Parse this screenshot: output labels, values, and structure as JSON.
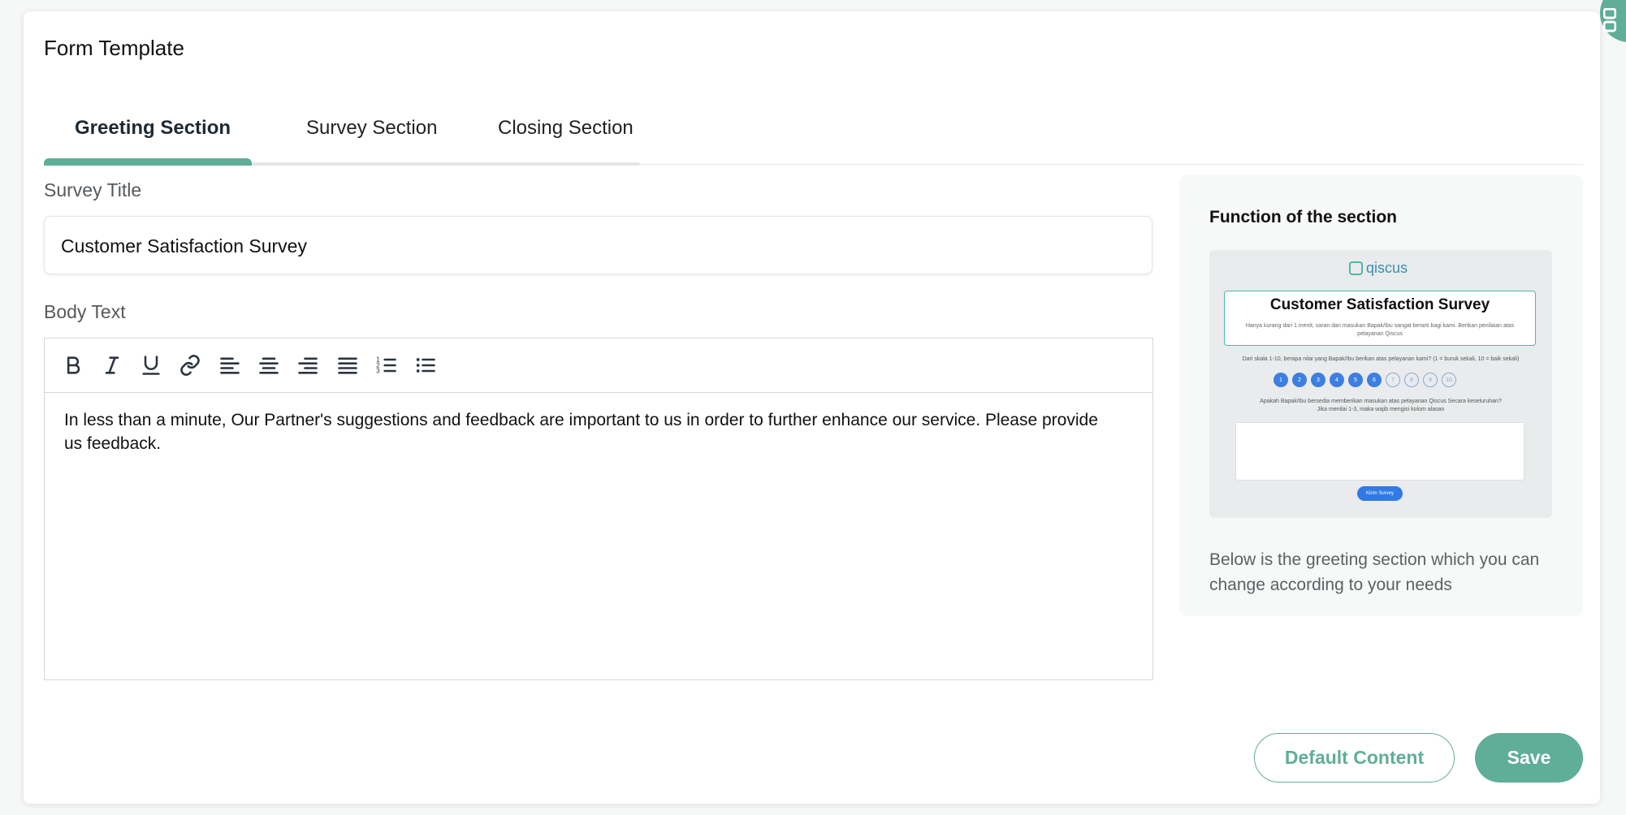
{
  "page": {
    "title": "Form Template"
  },
  "tabs": [
    {
      "label": "Greeting Section",
      "active": true
    },
    {
      "label": "Survey Section",
      "active": false
    },
    {
      "label": "Closing Section",
      "active": false
    }
  ],
  "survey_title": {
    "label": "Survey Title",
    "value": "Customer Satisfaction Survey"
  },
  "body_text": {
    "label": "Body Text",
    "content": "In less than a minute, Our Partner's suggestions and feedback are important to us in order to further enhance our service. Please provide us feedback.",
    "toolbar": [
      "bold-icon",
      "italic-icon",
      "underline-icon",
      "link-icon",
      "align-left-icon",
      "align-center-icon",
      "align-right-icon",
      "align-justify-icon",
      "ordered-list-icon",
      "bullet-list-icon"
    ]
  },
  "info_panel": {
    "title": "Function of the section",
    "description": "Below is the greeting section which you can change according to your needs",
    "preview": {
      "logo_text": "qiscus",
      "heading": "Customer Satisfaction Survey",
      "subtext": "Hanya kurang dari 1 menit, saran dan masukan Bapak/Ibu sangat berarti bagi kami. Berikan penilaian atas pelayanan Qiscus",
      "question1": "Dari skala 1-10, berapa nilai yang Bapak/Ibu berikan atas pelayanan kami? (1 = buruk sekali, 10 = baik sekali)",
      "scale": [
        "1",
        "2",
        "3",
        "4",
        "5",
        "6",
        "7",
        "8",
        "9",
        "10"
      ],
      "selected_up_to": 6,
      "question2_line1": "Apakah Bapak/Ibu bersedia memberikan masukan atas pelayanan Qiscus Secara keseluruhan?",
      "question2_line2": "Jika menilai 1-3, maka wajib mengisi kolom alasan",
      "submit_label": "Kirim Survey"
    }
  },
  "actions": {
    "default_label": "Default Content",
    "save_label": "Save"
  },
  "colors": {
    "accent": "#5fae97",
    "preview_blue": "#3d7fe0"
  }
}
